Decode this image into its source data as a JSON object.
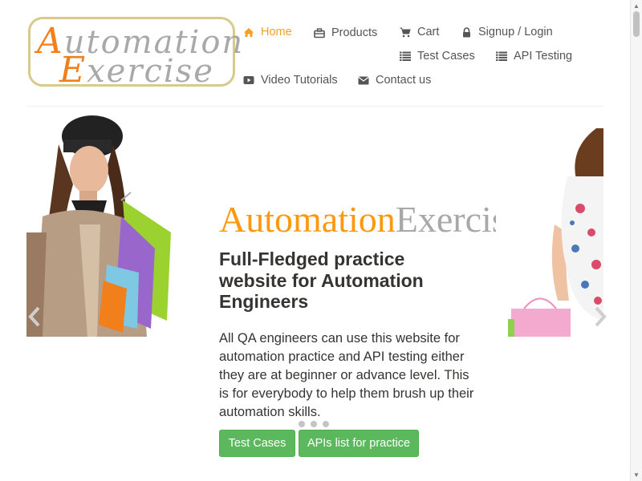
{
  "logo": {
    "line1": "Automation",
    "line2": "Exercise"
  },
  "nav": {
    "home": "Home",
    "products": "Products",
    "cart": "Cart",
    "login": "Signup / Login",
    "test_cases": "Test Cases",
    "api_testing": "API Testing",
    "video_tutorials": "Video Tutorials",
    "contact_us": "Contact us"
  },
  "hero": {
    "title_part1": "Automation",
    "title_part2": "Exercise",
    "subtitle": "Full-Fledged practice website for Automation Engineers",
    "description": "All QA engineers can use this website for automation practice and API testing either they are at beginner or advance level. This is for everybody to help them brush up their automation skills.",
    "btn_test_cases": "Test Cases",
    "btn_apis": "APIs list for practice"
  },
  "colors": {
    "accent": "#fe980f",
    "button": "#5cb85c",
    "nav_text": "#555555"
  },
  "icons": [
    "home-icon",
    "briefcase-icon",
    "shopping-cart-icon",
    "lock-icon",
    "list-icon",
    "youtube-play-icon",
    "envelope-icon",
    "chevron-left-icon",
    "chevron-right-icon"
  ],
  "carousel": {
    "slides": 3
  }
}
